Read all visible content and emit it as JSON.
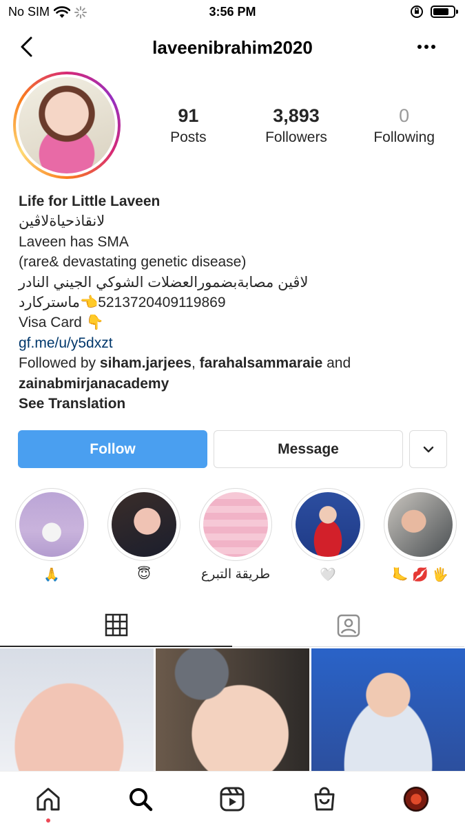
{
  "status_bar": {
    "carrier": "No SIM",
    "time": "3:56 PM"
  },
  "header": {
    "username": "laveenibrahim2020"
  },
  "profile": {
    "posts_count": "91",
    "posts_label": "Posts",
    "followers_count": "3,893",
    "followers_label": "Followers",
    "following_count": "0",
    "following_label": "Following"
  },
  "bio": {
    "name": "Life for Little Laveen",
    "line1": "لانقاذحياةلاڤين",
    "line2": "Laveen has SMA",
    "line3": "(rare& devastating genetic disease)",
    "line4": "لاڤين مصابةبضمورالعضلات الشوكي الجيني النادر",
    "line5": "5213720409119869👈ماستركارد",
    "line6": "Visa Card 👇",
    "link": "gf.me/u/y5dxzt",
    "followed_by_prefix": "Followed by ",
    "followed_by_user1": "siham.jarjees",
    "followed_by_sep": ", ",
    "followed_by_user2": "farahalsammaraie",
    "followed_by_and": " and",
    "followed_by_user3": "zainabmirjanacademy",
    "see_translation": "See Translation"
  },
  "actions": {
    "follow_label": "Follow",
    "message_label": "Message"
  },
  "highlights": [
    {
      "label": "🙏"
    },
    {
      "label": "😇"
    },
    {
      "label": "طريقة التبرع"
    },
    {
      "label": "🤍"
    },
    {
      "label": "🦶 💋 🖐"
    }
  ],
  "tabs": {
    "grid_icon": "grid-icon",
    "tagged_icon": "tagged-icon"
  },
  "bottom_nav": [
    "home-icon",
    "search-icon",
    "reels-icon",
    "shop-icon",
    "profile-avatar"
  ],
  "colors": {
    "follow_button": "#4a9ff0",
    "link": "#00376b",
    "notification_dot": "#ed4956"
  }
}
